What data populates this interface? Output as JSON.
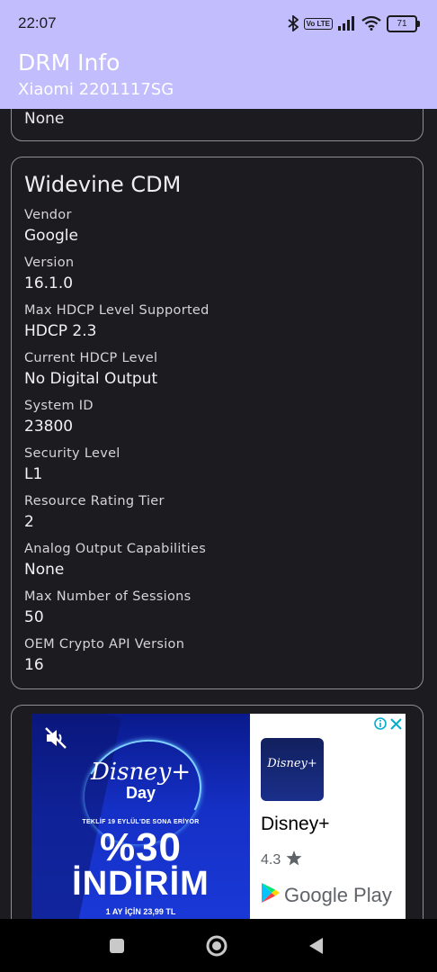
{
  "status": {
    "time": "22:07",
    "volte_label": "Vo LTE",
    "battery_level": "71"
  },
  "appbar": {
    "title": "DRM Info",
    "subtitle": "Xiaomi 2201117SG"
  },
  "previous_card": {
    "value": "None"
  },
  "widevine": {
    "title": "Widevine CDM",
    "fields": [
      {
        "label": "Vendor",
        "value": "Google"
      },
      {
        "label": "Version",
        "value": "16.1.0"
      },
      {
        "label": "Max HDCP Level Supported",
        "value": "HDCP 2.3"
      },
      {
        "label": "Current HDCP Level",
        "value": "No Digital Output"
      },
      {
        "label": "System ID",
        "value": "23800"
      },
      {
        "label": "Security Level",
        "value": "L1"
      },
      {
        "label": "Resource Rating Tier",
        "value": "2"
      },
      {
        "label": "Analog Output Capabilities",
        "value": "None"
      },
      {
        "label": "Max Number of Sessions",
        "value": "50"
      },
      {
        "label": "OEM Crypto API Version",
        "value": "16"
      }
    ]
  },
  "ad": {
    "brand_logo_text": "Disney+",
    "brand_day": "Day",
    "promo_note": "TEKLİF 19 EYLÜL'DE SONA ERİYOR",
    "promo_percent": "%30",
    "promo_word": "İNDİRİM",
    "price_note": "1 AY İÇİN 23,99 TL",
    "app_icon_text": "Disney+",
    "app_name": "Disney+",
    "rating": "4.3",
    "store_name": "Google Play"
  },
  "colors": {
    "header_bg": "#c2bdfc",
    "page_bg": "#1c1b1f",
    "card_border": "#8f8e95"
  }
}
